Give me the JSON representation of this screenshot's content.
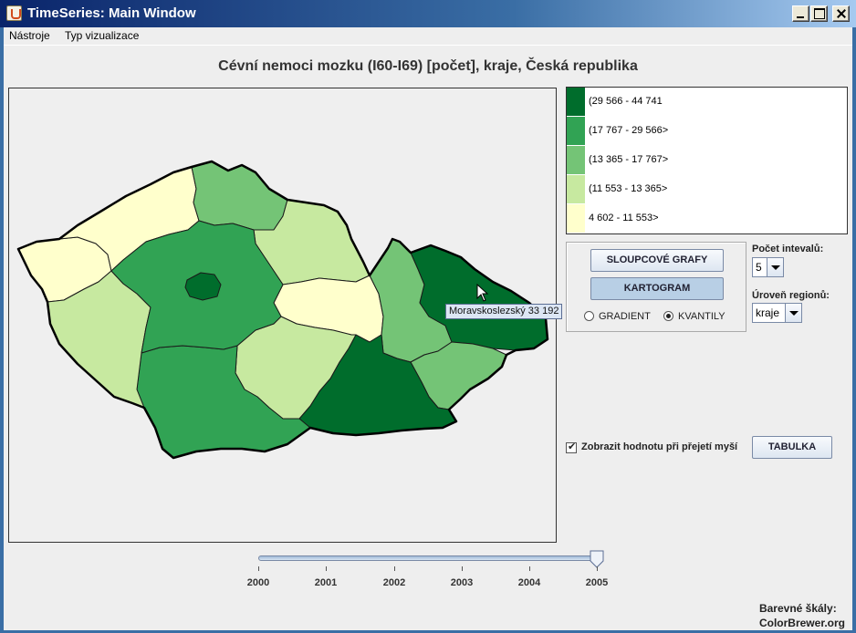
{
  "window": {
    "title": "TimeSeries: Main Window"
  },
  "menu": {
    "items": [
      "Nástroje",
      "Typ vizualizace"
    ]
  },
  "map": {
    "title": "Cévní nemoci mozku (I60-I69) [počet], kraje, Česká republika",
    "tooltip": "Moravskoslezský 33 192",
    "colors": {
      "class1": "#006d2c",
      "class2": "#31a354",
      "class3": "#74c476",
      "class4": "#c7e9a0",
      "class5": "#ffffcc",
      "border": "#000000"
    },
    "regions": [
      {
        "name": "Karlovarský",
        "class": 5
      },
      {
        "name": "Ústecký",
        "class": 5
      },
      {
        "name": "Liberecký",
        "class": 3
      },
      {
        "name": "Královéhradecký",
        "class": 4
      },
      {
        "name": "Pardubický",
        "class": 5
      },
      {
        "name": "Olomoucký",
        "class": 3
      },
      {
        "name": "Moravskoslezský",
        "class": 1
      },
      {
        "name": "Zlínský",
        "class": 3
      },
      {
        "name": "Jihomoravský",
        "class": 1
      },
      {
        "name": "Vysočina",
        "class": 4
      },
      {
        "name": "Jihočeský",
        "class": 2
      },
      {
        "name": "Plzeňský",
        "class": 4
      },
      {
        "name": "Středočeský",
        "class": 2
      },
      {
        "name": "Praha",
        "class": 1
      }
    ]
  },
  "legend": {
    "items": [
      {
        "label": "(29 566 - 44 741",
        "color": "#006d2c"
      },
      {
        "label": "(17 767 - 29 566>",
        "color": "#31a354"
      },
      {
        "label": "(13 365 - 17 767>",
        "color": "#74c476"
      },
      {
        "label": "(11 553 - 13 365>",
        "color": "#c7e9a0"
      },
      {
        "label": "4 602 - 11 553>",
        "color": "#ffffcc"
      }
    ]
  },
  "controls": {
    "bar_charts_button": "SLOUPCOVÉ GRAFY",
    "cartogram_button": "KARTOGRAM",
    "radio_gradient": "GRADIENT",
    "radio_quantiles": "KVANTILY",
    "selected_mode": "KVANTILY",
    "intervals_label": "Počet intevalů:",
    "intervals_value": "5",
    "region_level_label": "Úroveň regionů:",
    "region_level_value": "kraje",
    "show_value_label": "Zobrazit hodnotu při přejetí myší",
    "show_value_checked": true,
    "table_button": "TABULKA"
  },
  "timeline": {
    "years": [
      "2000",
      "2001",
      "2002",
      "2003",
      "2004",
      "2005"
    ],
    "selected": "2005"
  },
  "credits": {
    "line1": "Barevné škály:",
    "line2": "ColorBrewer.org"
  }
}
